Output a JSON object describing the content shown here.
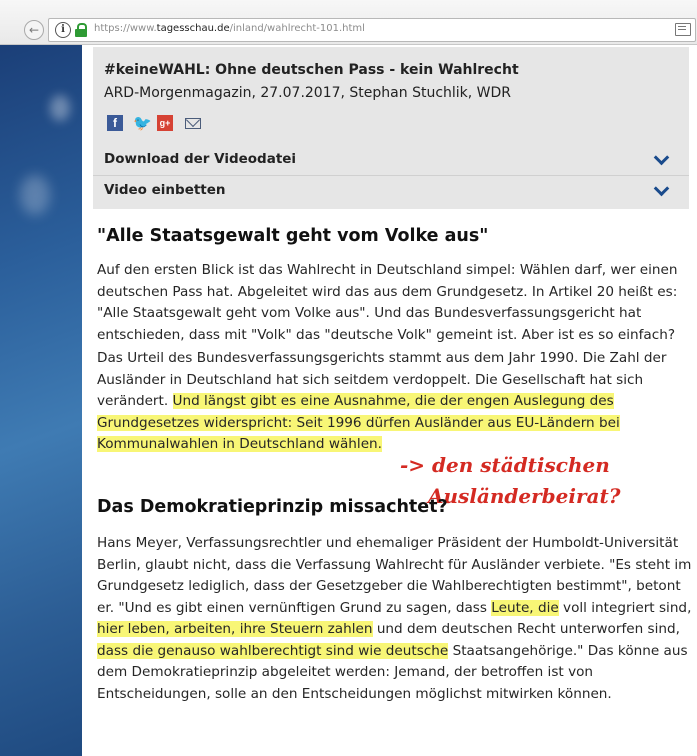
{
  "browser": {
    "back_label": "←",
    "info_label": "i",
    "url_prefix": "https://www.",
    "url_host": "tagesschau.de",
    "url_path": "/inland/wahlrecht-101.html"
  },
  "video": {
    "title": "#keineWAHL: Ohne deutschen Pass - kein Wahlrecht",
    "meta": "ARD-Morgenmagazin, 27.07.2017, Stephan Stuchlik, WDR",
    "share": {
      "facebook": "f",
      "twitter": "🐦",
      "googleplus": "g+"
    },
    "download_label": "Download der Videodatei",
    "embed_label": "Video einbetten"
  },
  "article": {
    "heading1": "\"Alle Staatsgewalt geht vom Volke aus\"",
    "p1": "Auf den ersten Blick ist das Wahlrecht in Deutschland simpel: Wählen darf, wer einen deutschen Pass hat. Abgeleitet wird das aus dem Grundgesetz. In Artikel 20 heißt es: \"Alle Staatsgewalt geht vom Volke aus\". Und das Bundesverfassungsgericht hat entschieden, dass mit \"Volk\" das \"deutsche Volk\" gemeint ist. Aber ist es so einfach?",
    "p2_a": "Das Urteil des Bundesverfassungsgerichts stammt aus dem Jahr 1990. Die Zahl der Ausländer in Deutschland hat sich seitdem verdoppelt. Die Gesellschaft hat sich verändert. ",
    "p2_hl": "Und längst gibt es eine Ausnahme, die der engen Auslegung des Grundgesetzes widerspricht: Seit 1996 dürfen Ausländer aus EU-Ländern bei Kommunalwahlen in Deutschland wählen.",
    "heading2": "Das Demokratieprinzip missachtet?",
    "p3_a": "Hans Meyer, Verfassungsrechtler und ehemaliger Präsident der Humboldt-Universität Berlin, glaubt nicht, dass die Verfassung Wahlrecht für Ausländer verbiete. \"Es steht im Grundgesetz lediglich, dass der Gesetzgeber die Wahlberechtigten bestimmt\", betont er. \"Und es gibt einen vernünftigen Grund zu sagen, dass ",
    "p3_hl1": "Leute, die",
    "p3_b": " voll integriert sind, ",
    "p3_hl2": "hier leben, arbeiten, ihre Steuern zahlen",
    "p3_c": " und dem deutschen Recht unterworfen sind, ",
    "p3_hl3": "dass die genauso wahlberechtigt sind wie deutsche",
    "p3_d": " Staatsangehörige.\" Das könne aus dem Demokratieprinzip abgeleitet werden: Jemand, der betroffen ist von Entscheidungen, solle an den Entscheidungen möglichst mitwirken können."
  },
  "annotation": {
    "line1": "-> den städtischen",
    "line2": "Ausländerbeirat?",
    "color": "#d42a22"
  },
  "colors": {
    "highlight": "#f8f676",
    "chevron": "#1a4b8c",
    "facebook": "#3b5a98",
    "twitter": "#2aa9e0",
    "googleplus": "#d64234"
  }
}
